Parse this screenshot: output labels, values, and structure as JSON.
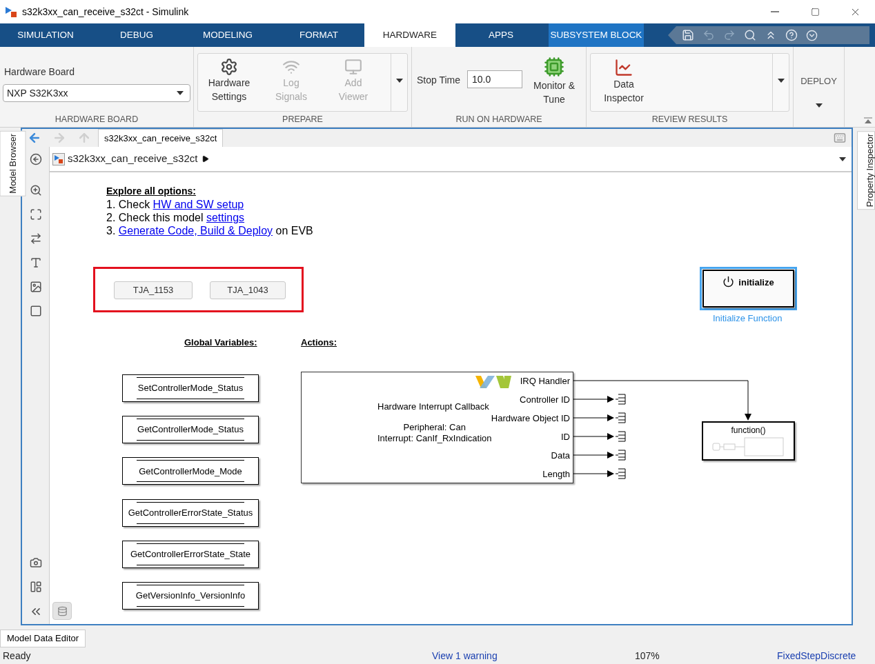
{
  "window": {
    "title": "s32k3xx_can_receive_s32ct - Simulink"
  },
  "tabs": [
    {
      "label": "SIMULATION",
      "selected": false,
      "kind": "normal"
    },
    {
      "label": "DEBUG",
      "selected": false,
      "kind": "normal"
    },
    {
      "label": "MODELING",
      "selected": false,
      "kind": "normal"
    },
    {
      "label": "FORMAT",
      "selected": false,
      "kind": "normal"
    },
    {
      "label": "HARDWARE",
      "selected": true,
      "kind": "normal"
    },
    {
      "label": "APPS",
      "selected": false,
      "kind": "normal"
    },
    {
      "label": "SUBSYSTEM BLOCK",
      "selected": false,
      "kind": "contextual"
    }
  ],
  "ribbon": {
    "hardware_board": {
      "label": "Hardware Board",
      "value": "NXP S32K3xx",
      "section": "HARDWARE BOARD"
    },
    "prepare": {
      "section": "PREPARE",
      "buttons": [
        {
          "label": "Hardware Settings",
          "disabled": false,
          "kind": "settings"
        },
        {
          "label": "Log Signals",
          "disabled": true,
          "kind": "log"
        },
        {
          "label": "Add Viewer",
          "disabled": true,
          "kind": "viewer"
        }
      ]
    },
    "run_on_hardware": {
      "section": "RUN ON HARDWARE",
      "stop_time_label": "Stop Time",
      "stop_time": "10.0",
      "monitor": "Monitor & Tune"
    },
    "review_results": {
      "section": "REVIEW RESULTS",
      "button": "Data Inspector"
    },
    "deploy": {
      "section": "DEPLOY"
    }
  },
  "side_panels": {
    "left": "Model Browser",
    "right": "Property Inspector"
  },
  "editor": {
    "tab": "s32k3xx_can_receive_s32ct",
    "breadcrumb": "s32k3xx_can_receive_s32ct"
  },
  "canvas": {
    "instructions": {
      "title": "Explore all options:",
      "lines": [
        {
          "before": "1. Check ",
          "link": "HW and SW setup"
        },
        {
          "before": "2. Check this model ",
          "link": "settings"
        },
        {
          "before": "3. ",
          "link": "Generate Code, Build & Deploy",
          "after": " on EVB"
        }
      ]
    },
    "transceiver_buttons": [
      "TJA_1153",
      "TJA_1043"
    ],
    "global_variables": {
      "heading": "Global Variables:",
      "stores": [
        "SetControllerMode_Status",
        "GetControllerMode_Status",
        "GetControllerMode_Mode",
        "GetControllerErrorState_Status",
        "GetControllerErrorState_State",
        "GetVersionInfo_VersionInfo"
      ]
    },
    "actions": {
      "heading": "Actions:",
      "block": {
        "title": "Hardware Interrupt Callback",
        "lines": [
          "Peripheral: Can",
          "Interrupt: CanIf_RxIndication"
        ],
        "ports": [
          {
            "label": "IRQ Handler",
            "kind": "function_call"
          },
          {
            "label": "Controller ID",
            "kind": "terminator"
          },
          {
            "label": "Hardware Object ID",
            "kind": "terminator"
          },
          {
            "label": "ID",
            "kind": "terminator"
          },
          {
            "label": "Data",
            "kind": "terminator"
          },
          {
            "label": "Length",
            "kind": "terminator"
          }
        ]
      }
    },
    "initialize": {
      "label": "initialize",
      "caption": "Initialize Function",
      "selected": true
    },
    "function_block": {
      "label": "function()"
    }
  },
  "bottom_tabs": [
    "Model Data Editor"
  ],
  "status_bar": {
    "state": "Ready",
    "warning": "View 1 warning",
    "zoom": "107%",
    "solver": "FixedStepDiscrete"
  }
}
